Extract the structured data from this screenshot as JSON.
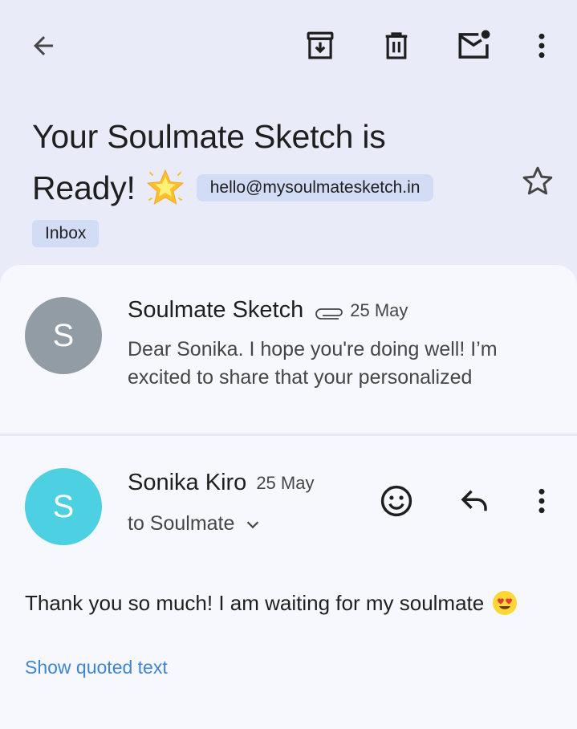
{
  "toolbar": {
    "back_icon": "arrow-left-icon",
    "archive_icon": "archive-icon",
    "delete_icon": "trash-icon",
    "mark_unread_icon": "mail-unread-icon",
    "more_icon": "more-vert-icon"
  },
  "subject": {
    "line1": "Your Soulmate Sketch is",
    "line2": "Ready!",
    "emoji_icon": "glowing-star-icon",
    "sender_chip": "hello@mysoulmatesketch.in",
    "star_icon": "star-outline-icon"
  },
  "labels": [
    "Inbox"
  ],
  "messages": [
    {
      "avatar_letter": "S",
      "avatar_color": "#919ca5",
      "sender": "Soulmate Sketch",
      "attachment_icon": "paperclip-icon",
      "date": "25 May",
      "snippet": "Dear Sonika. I hope you're doing well! I’m excited to share that your personalized"
    },
    {
      "avatar_letter": "S",
      "avatar_color": "#4dd0e1",
      "sender": "Sonika Kiro",
      "date": "25 May",
      "recipient": "to Soulmate",
      "body": "Thank you so much! I am waiting for my soulmate",
      "body_emoji_icon": "heart-eyes-emoji-icon",
      "quoted_link": "Show quoted text"
    }
  ],
  "colors": {
    "background": "#e9ecf8",
    "sheet": "#f7f8fd",
    "chip": "#d3dcf5",
    "link": "#3d84d4"
  }
}
